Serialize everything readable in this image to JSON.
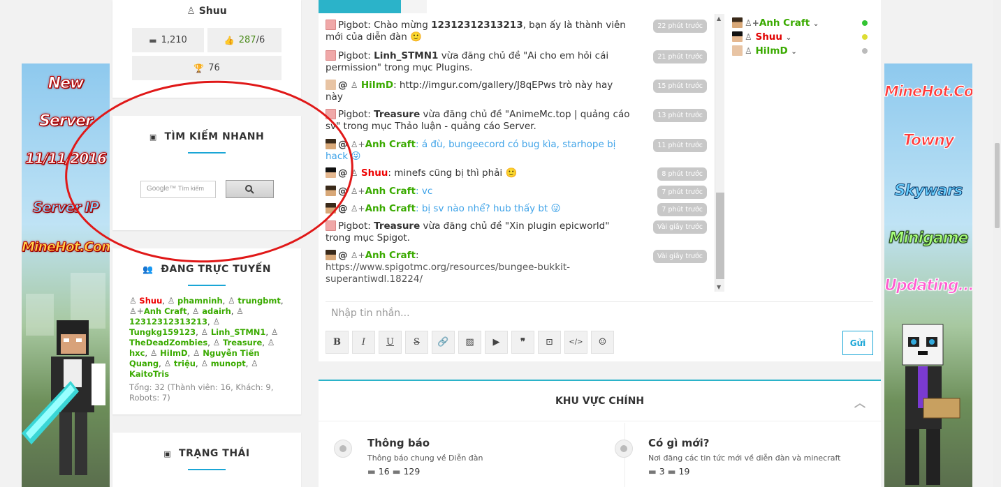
{
  "profile": {
    "username": "Shuu",
    "messages": "1,210",
    "likes": "287",
    "likes_suffix": "/6",
    "trophies": "76"
  },
  "search_widget": {
    "title": "TÌM KIẾM NHANH",
    "placeholder": "Tìm kiếm",
    "google_label": "Google™",
    "button_icon": "search-icon"
  },
  "online_widget": {
    "title": "ĐANG TRỰC TUYẾN",
    "users": [
      "Shuu",
      "phamninh",
      "trungbmt",
      "Anh Craft",
      "adairh",
      "12312312313213",
      "Tungkg159123",
      "Linh_STMN1",
      "TheDeadZombies",
      "Treasure",
      "hxc",
      "HiImD",
      "Nguyễn Tiến Quang",
      "triệu",
      "munopt",
      "KaitoTris"
    ],
    "total": "Tổng: 32 (Thành viên: 16, Khách: 9, Robots: 7)"
  },
  "status_widget": {
    "title": "TRẠNG THÁI"
  },
  "left_banner": {
    "lines": [
      "New",
      "Server",
      "11/11/2016",
      "Server IP",
      "MineHot.Com"
    ]
  },
  "right_banner": {
    "lines": [
      "MineHot.Com",
      "Towny",
      "Skywars",
      "Minigame",
      "Updating..."
    ]
  },
  "chat": {
    "messages": [
      {
        "name": "Pigbot",
        "text_a": ": Chào mừng ",
        "bold": "12312312313213",
        "text_b": ", bạn ấy là thành viên mới của diễn đàn 🙂",
        "time": "22 phút trước"
      },
      {
        "name": "Pigbot",
        "text_a": ": ",
        "bold": "Linh_STMN1",
        "text_b": " vừa đăng chủ đề \"Ai cho em hỏi cái permission\" trong mục Plugins.",
        "time": "21 phút trước"
      },
      {
        "name": "HiImD",
        "text_a": ": http://imgur.com/gallery/J8qEPws trò này hay này",
        "bold": "",
        "text_b": "",
        "time": "15 phút trước"
      },
      {
        "name": "Pigbot",
        "text_a": ": ",
        "bold": "Treasure",
        "text_b": " vừa đăng chủ đề \"AnimeMc.top | quảng cáo sv\" trong mục Thảo luận - quảng cáo Server.",
        "time": "13 phút trước"
      },
      {
        "name": "Anh Craft",
        "text_a": ": á đù, bungeecord có bug kìa, starhope bị hack 😜",
        "bold": "",
        "text_b": "",
        "time": "11 phút trước"
      },
      {
        "name": "Shuu",
        "text_a": ": minefs cũng bị thì phải 🙂",
        "bold": "",
        "text_b": "",
        "time": "8 phút trước"
      },
      {
        "name": "Anh Craft",
        "text_a": ": vc",
        "bold": "",
        "text_b": "",
        "time": "7 phút trước"
      },
      {
        "name": "Anh Craft",
        "text_a": ": bị sv nào nhể? hub thấy bt 😜",
        "bold": "",
        "text_b": "",
        "time": "7 phút trước"
      },
      {
        "name": "Pigbot",
        "text_a": ": ",
        "bold": "Treasure",
        "text_b": " vừa đăng chủ đề \"Xin plugin epicworld\" trong mục Spigot.",
        "time": "Vài giây trước"
      },
      {
        "name": "Anh Craft",
        "text_a": ":",
        "bold": "",
        "text_b": "https://www.spigotmc.org/resources/bungee-bukkit-superantiwdl.18224/",
        "time": "Vài giây trước"
      }
    ],
    "at": "@",
    "user_list": [
      {
        "name": "Anh Craft",
        "color": "#3aaa00",
        "status": "#33c433"
      },
      {
        "name": "Shuu",
        "color": "#e00000",
        "status": "#dddd33"
      },
      {
        "name": "HiImD",
        "color": "#3aaa00",
        "status": "#bbbbbb"
      }
    ],
    "input_placeholder": "Nhập tin nhắn...",
    "send_label": "Gửi",
    "toolbar": [
      "B",
      "I",
      "U",
      "S",
      "link-icon",
      "image-icon",
      "media-icon",
      "quote-icon",
      "spoiler-icon",
      "code-icon",
      "smiley-icon"
    ]
  },
  "forum": {
    "section_title": "KHU VỰC CHÍNH",
    "nodes": [
      {
        "title": "Thông báo",
        "desc": "Thông báo chung về Diễn đàn",
        "threads": "16",
        "posts": "129"
      },
      {
        "title": "Có gì mới?",
        "desc": "Nơi đăng các tin tức mới về diễn đàn và minecraft",
        "threads": "3",
        "posts": "19"
      }
    ]
  }
}
